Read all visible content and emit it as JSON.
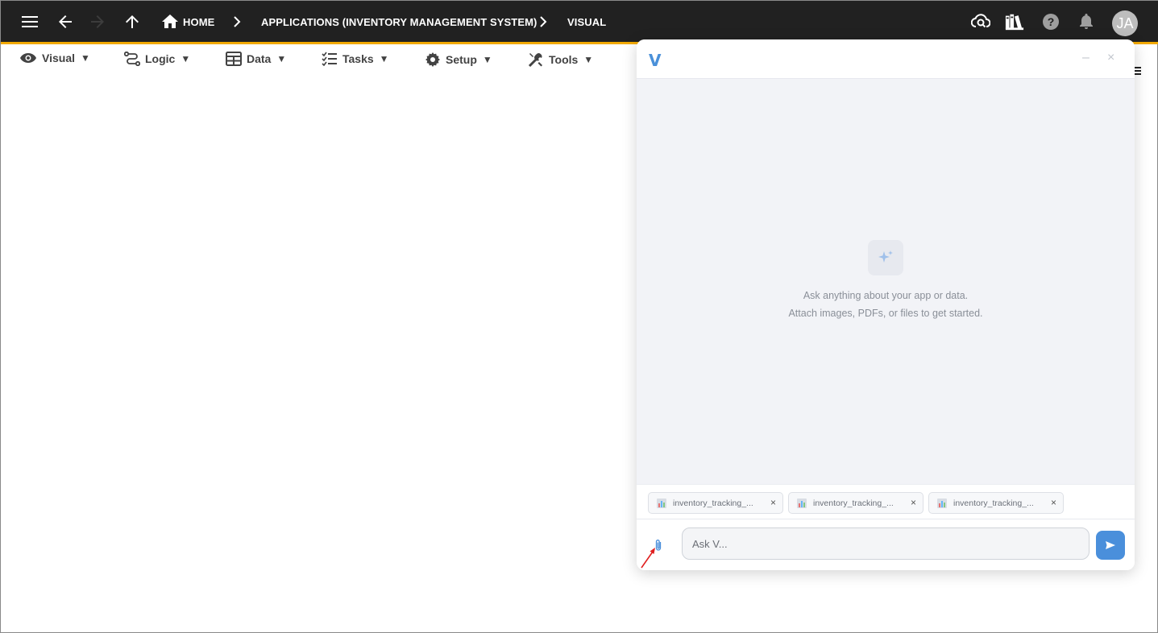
{
  "topbar": {
    "breadcrumbs": {
      "home": "HOME",
      "app": "APPLICATIONS (INVENTORY MANAGEMENT SYSTEM)",
      "page": "VISUAL"
    },
    "icons": [
      "menu-icon",
      "back-arrow-icon",
      "forward-arrow-icon",
      "up-arrow-icon",
      "home-icon",
      "cloud-search-icon",
      "library-books-icon",
      "help-icon",
      "notifications-bell-icon"
    ],
    "avatar_initials": "JA",
    "accent_color": "#f2a900",
    "background_color": "#212121"
  },
  "menu": {
    "visual": "Visual",
    "logic": "Logic",
    "data": "Data",
    "tasks": "Tasks",
    "setup": "Setup",
    "tools": "Tools",
    "caret": "▼"
  },
  "assistant": {
    "logo": "V",
    "minimize": "–",
    "close": "×",
    "empty_line1": "Ask anything about your app or data.",
    "empty_line2": "Attach images, PDFs, or files to get started.",
    "attachments": [
      {
        "name": "inventory_tracking_..."
      },
      {
        "name": "inventory_tracking_..."
      },
      {
        "name": "inventory_tracking_..."
      }
    ],
    "input_placeholder": "Ask V...",
    "brand_color": "#4a8fdb"
  }
}
